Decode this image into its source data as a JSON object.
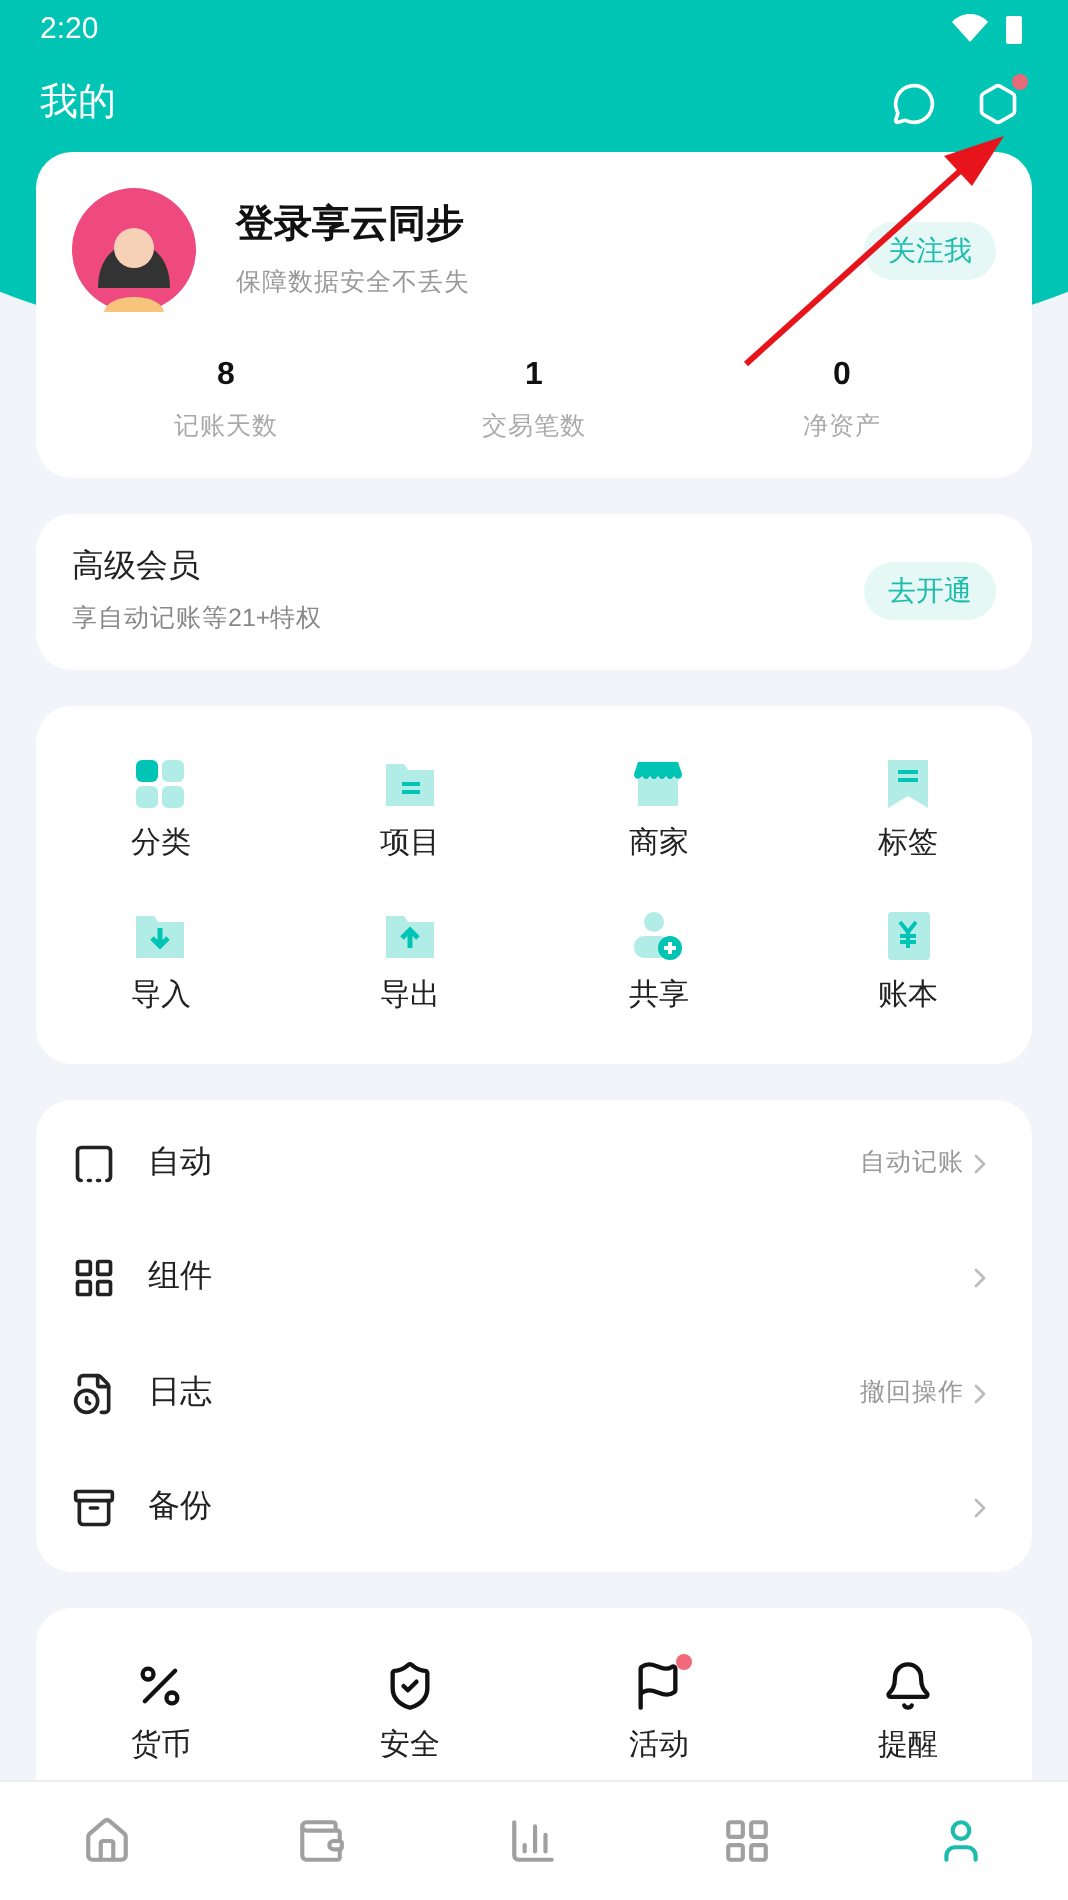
{
  "status_bar": {
    "time": "2:20"
  },
  "header": {
    "title": "我的",
    "settings_badge": true
  },
  "profile": {
    "name": "登录享云同步",
    "subtitle": "保障数据安全不丢失",
    "follow_button": "关注我",
    "stats": [
      {
        "value": "8",
        "label": "记账天数"
      },
      {
        "value": "1",
        "label": "交易笔数"
      },
      {
        "value": "0",
        "label": "净资产"
      }
    ]
  },
  "membership": {
    "title": "高级会员",
    "subtitle": "享自动记账等21+特权",
    "button": "去开通"
  },
  "tools": [
    {
      "label": "分类"
    },
    {
      "label": "项目"
    },
    {
      "label": "商家"
    },
    {
      "label": "标签"
    },
    {
      "label": "导入"
    },
    {
      "label": "导出"
    },
    {
      "label": "共享"
    },
    {
      "label": "账本"
    }
  ],
  "menu": [
    {
      "label": "自动",
      "hint": "自动记账"
    },
    {
      "label": "组件"
    },
    {
      "label": "日志",
      "hint": "撤回操作"
    },
    {
      "label": "备份"
    }
  ],
  "more": [
    {
      "label": "货币",
      "badge": false
    },
    {
      "label": "安全",
      "badge": false
    },
    {
      "label": "活动",
      "badge": true
    },
    {
      "label": "提醒",
      "badge": false
    }
  ],
  "tab_bar": [
    {
      "selected": false
    },
    {
      "selected": false
    },
    {
      "selected": false
    },
    {
      "selected": false
    },
    {
      "selected": true
    }
  ]
}
